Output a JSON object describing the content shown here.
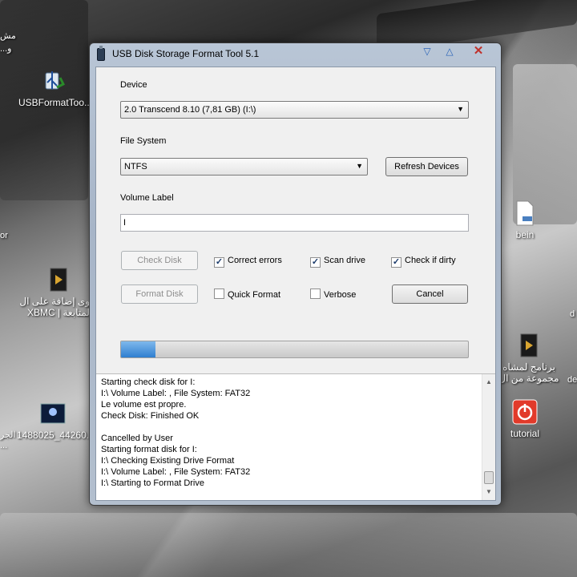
{
  "desktop": {
    "icons": {
      "usbformat": "USBFormatToo...",
      "arabic1_line1": "أقوى إضافة على ال",
      "arabic1_line2": "XBMC | لمتابعة",
      "image": "1488025_44260...",
      "bein": "bein",
      "arabic2_line1": "برنامج لمشاه",
      "arabic2_line2": "مجموعة من ال",
      "tutorial": "tutorial"
    },
    "edges": {
      "topleft1": "مش",
      "topleft2": "...و",
      "left_or": "or",
      "left_ar1": "الجر",
      "left_ar2": "...",
      "right_d1": "d",
      "right_d2": "de"
    }
  },
  "window": {
    "title": "USB Disk Storage Format Tool 5.1",
    "device_label": "Device",
    "device_value": "2.0  Transcend  8.10 (7,81 GB) (I:\\)",
    "filesystem_label": "File System",
    "filesystem_value": "NTFS",
    "refresh_button": "Refresh Devices",
    "volume_label": "Volume Label",
    "volume_value": "I",
    "check_disk_button": "Check Disk",
    "format_disk_button": "Format Disk",
    "cancel_button": "Cancel",
    "options": {
      "correct_errors": "Correct errors",
      "scan_drive": "Scan drive",
      "check_if_dirty": "Check if dirty",
      "quick_format": "Quick Format",
      "verbose": "Verbose"
    },
    "checked": {
      "correct_errors": true,
      "scan_drive": true,
      "check_if_dirty": true,
      "quick_format": false,
      "verbose": false
    },
    "progress_fraction": 0.1,
    "log": [
      "Starting check disk for I:",
      "I:\\ Volume Label: , File System: FAT32",
      "Le volume est propre.",
      "Check Disk: Finished OK",
      "",
      "Cancelled by User",
      "Starting format disk for I:",
      "I:\\ Checking Existing Drive Format",
      "I:\\ Volume Label: , File System: FAT32",
      "I:\\ Starting to Format Drive"
    ]
  }
}
